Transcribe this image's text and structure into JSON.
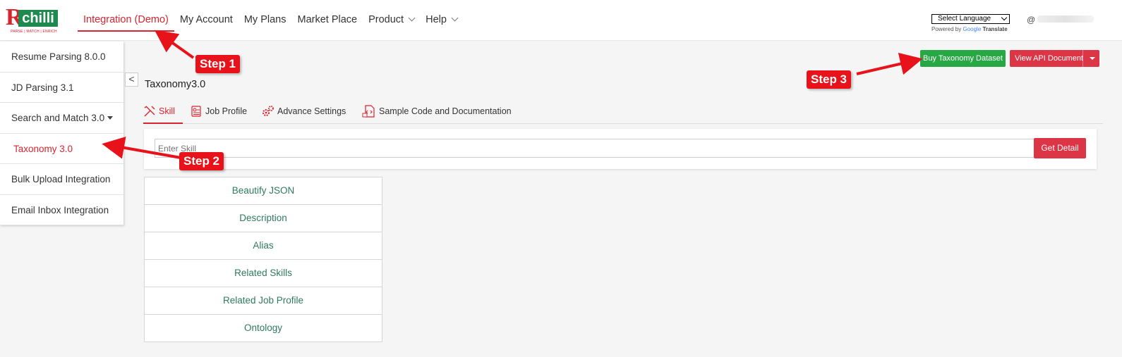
{
  "header": {
    "logo": {
      "letter": "R",
      "word": "chilli",
      "tagline": "PARSE | MATCH | ENRICH"
    },
    "nav": [
      {
        "label": "Integration (Demo)",
        "active": true
      },
      {
        "label": "My Account"
      },
      {
        "label": "My Plans"
      },
      {
        "label": "Market Place"
      },
      {
        "label": "Product",
        "dropdown": true
      },
      {
        "label": "Help",
        "dropdown": true
      }
    ],
    "language": {
      "selected": "Select Language",
      "powered_by": "Powered by",
      "google": "Google",
      "translate": "Translate"
    },
    "user_icon": "@"
  },
  "sidebar": {
    "items": [
      {
        "label": "Resume Parsing 8.0.0"
      },
      {
        "label": "JD Parsing 3.1"
      },
      {
        "label": "Search and Match 3.0",
        "dropdown": true
      },
      {
        "label": "Taxonomy 3.0",
        "active": true
      },
      {
        "label": "Bulk Upload Integration"
      },
      {
        "label": "Email Inbox Integration"
      }
    ],
    "collapse_glyph": "<"
  },
  "actions": {
    "buy_label": "Buy Taxonomy Dataset",
    "api_label": "View API Document"
  },
  "main": {
    "title": "Taxonomy3.0",
    "tabs": [
      {
        "label": "Skill",
        "icon": "tools-icon",
        "active": true
      },
      {
        "label": "Job Profile",
        "icon": "profile-doc-icon"
      },
      {
        "label": "Advance Settings",
        "icon": "gears-icon"
      },
      {
        "label": "Sample Code and Documentation",
        "icon": "code-doc-icon"
      }
    ],
    "search": {
      "placeholder": "Enter Skill",
      "button": "Get Detail"
    },
    "options": [
      "Beautify JSON",
      "Description",
      "Alias",
      "Related Skills",
      "Related Job Profile",
      "Ontology"
    ]
  },
  "annotations": {
    "step1": "Step 1",
    "step2": "Step 2",
    "step3": "Step 3"
  },
  "colors": {
    "accent": "#d9232d",
    "success": "#28a745",
    "danger": "#dc3545",
    "link_green": "#2f7a5e"
  }
}
